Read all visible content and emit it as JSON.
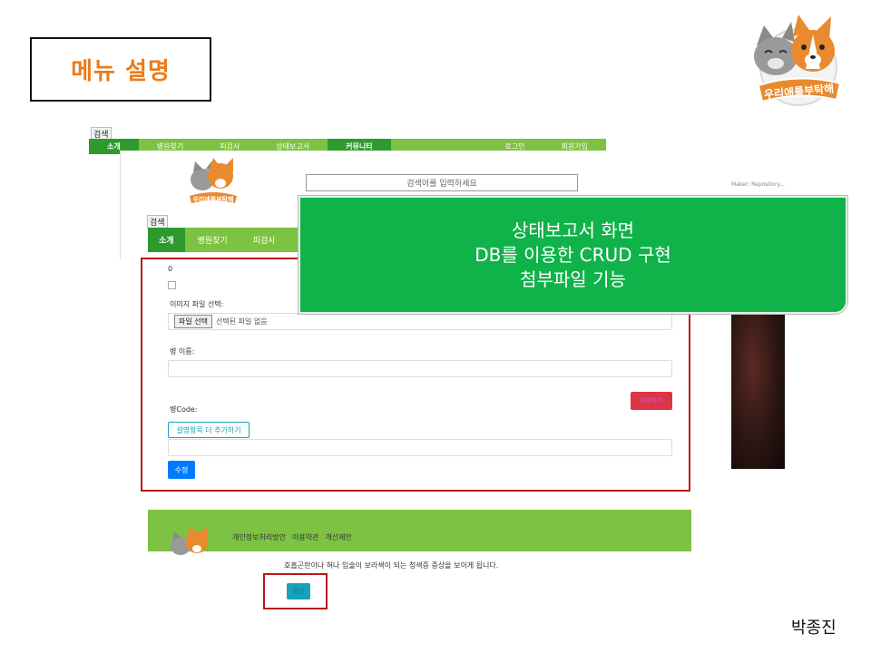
{
  "slide": {
    "title": "메뉴 설명",
    "author": "박종진",
    "logo_text": "우리애를부탁해"
  },
  "back_shot": {
    "search_tag": "검색",
    "nav": [
      "소개",
      "병원찾기",
      "피검사",
      "상태보고서",
      "커뮤니티"
    ],
    "nav_right": [
      "로그인",
      "회원가입"
    ]
  },
  "mid_shot": {
    "search_placeholder": "검색어를 입력하세요",
    "search_tag": "검색",
    "nav": [
      "소개",
      "병원찾기",
      "피검사"
    ],
    "side_text": "Maker: Repository..."
  },
  "callout": {
    "lines": [
      "상태보고서 화면",
      "DB를 이용한 CRUD 구현",
      "첨부파일 기능"
    ],
    "color": "#10b24a"
  },
  "form": {
    "counter": "0",
    "image_label": "이미지 파일 선택:",
    "file_button": "파일 선택",
    "file_status": "선택된 파일 없음",
    "name_label": "병 이름:",
    "delete_button": "삭제하기",
    "code_label": "병Code:",
    "add_button": "설명항목 더 추가하기",
    "save_button": "수정"
  },
  "footer": {
    "links": [
      "개인정보처리방안",
      "이용약관",
      "개선제안"
    ],
    "description": "호흡곤란이나 혀나 입술이 보라색이 되는 청색증 증상을 보이게 됩니다.",
    "confirm_button": "확인"
  },
  "colors": {
    "nav_green": "#7dc242",
    "nav_active": "#2e9a2e",
    "highlight_red": "#b31b1b",
    "title_orange": "#ee7a1a"
  }
}
